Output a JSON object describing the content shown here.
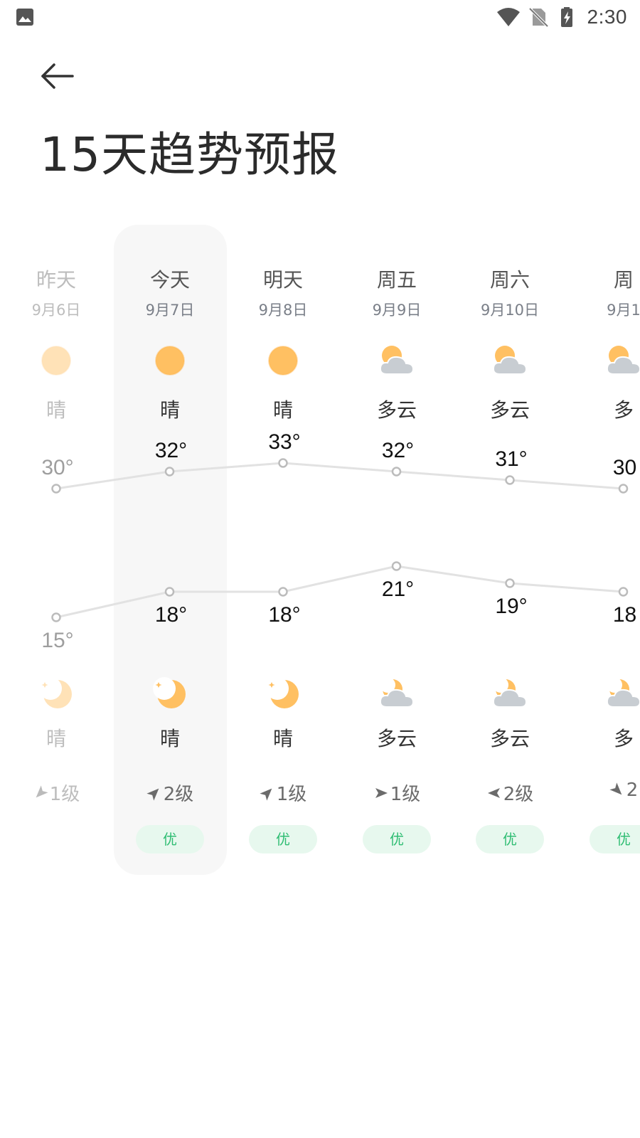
{
  "status_bar": {
    "time": "2:30",
    "left_icon": "image-icon",
    "right_icons": [
      "wifi-icon",
      "no-sim-icon",
      "battery-charging-icon"
    ]
  },
  "header": {
    "back_icon": "arrow-left-icon",
    "title": "15天趋势预报"
  },
  "colors": {
    "sun": "#ffc062",
    "cloud": "#c8cdd2",
    "aqi_text": "#2fbd73",
    "aqi_bg": "#e7f8ee",
    "line": "#e2e2e2",
    "highlight": "#f7f7f7"
  },
  "days": [
    {
      "name": "昨天",
      "date": "9月6日",
      "past": true,
      "day_icon": "sun-icon",
      "day_cond": "晴",
      "high": 30,
      "high_label": "30°",
      "low": 15,
      "low_label": "15°",
      "night_icon": "moon-icon",
      "night_cond": "晴",
      "wind_dir": "southwest",
      "wind_icon": "wind-direction-icon",
      "wind": "1级",
      "aqi": ""
    },
    {
      "name": "今天",
      "date": "9月7日",
      "past": false,
      "day_icon": "sun-icon",
      "day_cond": "晴",
      "high": 32,
      "high_label": "32°",
      "low": 18,
      "low_label": "18°",
      "night_icon": "moon-icon",
      "night_cond": "晴",
      "wind_dir": "northeast",
      "wind_icon": "wind-direction-icon",
      "wind": "2级",
      "aqi": "优"
    },
    {
      "name": "明天",
      "date": "9月8日",
      "past": false,
      "day_icon": "sun-icon",
      "day_cond": "晴",
      "high": 33,
      "high_label": "33°",
      "low": 18,
      "low_label": "18°",
      "night_icon": "moon-icon",
      "night_cond": "晴",
      "wind_dir": "northeast",
      "wind_icon": "wind-direction-icon",
      "wind": "1级",
      "aqi": "优"
    },
    {
      "name": "周五",
      "date": "9月9日",
      "past": false,
      "day_icon": "partly-cloudy-icon",
      "day_cond": "多云",
      "high": 32,
      "high_label": "32°",
      "low": 21,
      "low_label": "21°",
      "night_icon": "partly-cloudy-night-icon",
      "night_cond": "多云",
      "wind_dir": "east",
      "wind_icon": "wind-direction-icon",
      "wind": "1级",
      "aqi": "优"
    },
    {
      "name": "周六",
      "date": "9月10日",
      "past": false,
      "day_icon": "partly-cloudy-icon",
      "day_cond": "多云",
      "high": 31,
      "high_label": "31°",
      "low": 19,
      "low_label": "19°",
      "night_icon": "partly-cloudy-night-icon",
      "night_cond": "多云",
      "wind_dir": "west",
      "wind_icon": "wind-direction-icon",
      "wind": "2级",
      "aqi": "优"
    },
    {
      "name": "周",
      "date": "9月1",
      "past": false,
      "day_icon": "partly-cloudy-icon",
      "day_cond": "多",
      "high": 30,
      "high_label": "30",
      "low": 18,
      "low_label": "18",
      "night_icon": "partly-cloudy-night-icon",
      "night_cond": "多",
      "wind_dir": "southeast",
      "wind_icon": "wind-direction-icon",
      "wind": "2",
      "aqi": "优"
    }
  ]
}
